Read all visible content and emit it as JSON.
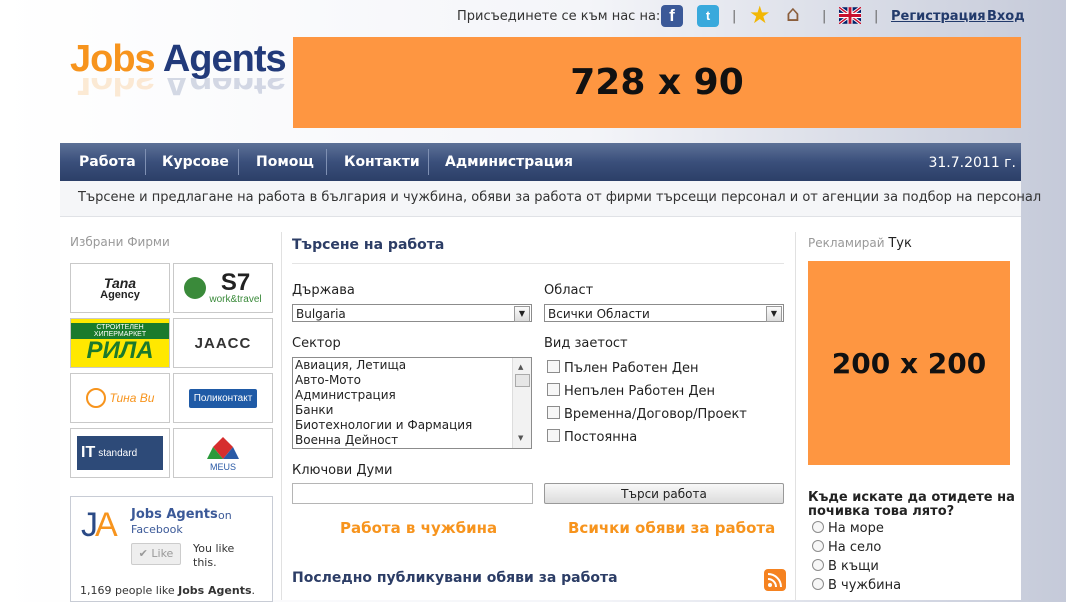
{
  "header": {
    "join_text": "Присъединете се към нас на:",
    "register": "Регистрация",
    "login": "Вход"
  },
  "logo": {
    "part1": "Jobs",
    "part2": "Agents"
  },
  "banners": {
    "top": "728 x 90",
    "side": "200 x 200"
  },
  "nav": {
    "items": [
      "Работа",
      "Курсове",
      "Помощ",
      "Контакти",
      "Администрация"
    ],
    "date": "31.7.2011 г."
  },
  "tagline": "Търсене и предлагане на работа в българия и чужбина, обяви за работа от фирми търсещи персонал и от агенции за подбор на персонал",
  "left": {
    "title": "Избрани Фирми",
    "companies": [
      {
        "name": "Tana Agency",
        "l1": "Tana",
        "l2": "Agency"
      },
      {
        "name": "S7 work&travel",
        "l1": "S7",
        "l2": "work&travel"
      },
      {
        "name": "Строителен хипермаркет РИЛА",
        "l1": "СТРОИТЕЛЕН ХИПЕРМАРКЕТ",
        "l2": "РИЛА"
      },
      {
        "name": "JAACC",
        "l1": "JAACC"
      },
      {
        "name": "Тина Ви",
        "l1": "Тина Ви"
      },
      {
        "name": "Поликонтакт",
        "l1": "Поликонтакт"
      },
      {
        "name": "IT standard",
        "l1": "IT",
        "l2": "standard"
      },
      {
        "name": "MEUS",
        "l1": "MEUS"
      }
    ],
    "facebook": {
      "name": "Jobs Agents",
      "on": "on",
      "site": "Facebook",
      "like": "Like",
      "you_like": "You like this.",
      "count_prefix": "1,169 people like ",
      "count_name": "Jobs Agents",
      "count_suffix": "."
    }
  },
  "search": {
    "title": "Търсене на работа",
    "country_label": "Държава",
    "country_value": "Bulgaria",
    "region_label": "Област",
    "region_value": "Всички Области",
    "sector_label": "Сектор",
    "sectors": [
      "Авиация, Летища",
      "Авто-Мото",
      "Администрация",
      "Банки",
      "Биотехнологии и Фармация",
      "Военна Дейност"
    ],
    "employment_label": "Вид заетост",
    "employment_types": [
      "Пълен Работен Ден",
      "Непълен Работен Ден",
      "Временна/Договор/Проект",
      "Постоянна"
    ],
    "keywords_label": "Ключови Думи",
    "keywords_value": "",
    "search_button": "Търси работа",
    "link_abroad": "Работа в чужбина",
    "link_all": "Всички обяви за работа",
    "latest_title": "Последно публикувани обяви за работа"
  },
  "right": {
    "advertise_prefix": "Рекламирай",
    "advertise_here": "Тук",
    "poll_question": "Къде искате да отидете на почивка това лято?",
    "poll_options": [
      "На море",
      "На село",
      "В къщи",
      "В чужбина"
    ]
  },
  "colors": {
    "brand_orange": "#f7941d",
    "brand_navy": "#223a7a",
    "ad_orange": "#fe9641",
    "nav_blue": "#3a4f7b"
  },
  "icons": [
    "facebook-icon",
    "twitter-icon",
    "star-icon",
    "home-icon",
    "uk-flag-icon",
    "rss-icon"
  ]
}
